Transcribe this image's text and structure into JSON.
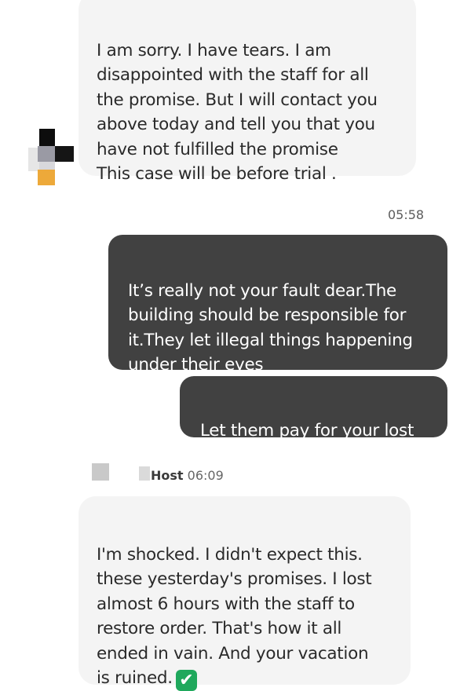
{
  "messages": [
    {
      "direction": "incoming",
      "text": "I am sorry. I have tears. I am\ndisappointed with the staff for all\nthe promise. But I will contact you\nabove today and tell you that you\nhave not fulfilled the promise\nThis case will be before trial ."
    },
    {
      "direction": "outgoing",
      "timestamp": "05:58",
      "text": "It’s really not your fault dear.The\nbuilding should be responsible for\nit.They let illegal things happening\nunder their eyes"
    },
    {
      "direction": "outgoing",
      "text": "Let them pay for your lost"
    },
    {
      "direction": "incoming",
      "sender": "Host",
      "time": "06:09",
      "text": "I'm shocked. I didn't expect this.\nthese yesterday's promises. I lost\nalmost 6 hours with the staff to\nrestore order. That's how it all\nended in vain. And your vacation\nis ruined.",
      "emoji": "✔",
      "emoji_name": "white-heavy-check-mark"
    }
  ],
  "colors": {
    "incoming_bg": "#f4f4f4",
    "outgoing_bg": "#414141",
    "emoji_green": "#1fa85c"
  }
}
